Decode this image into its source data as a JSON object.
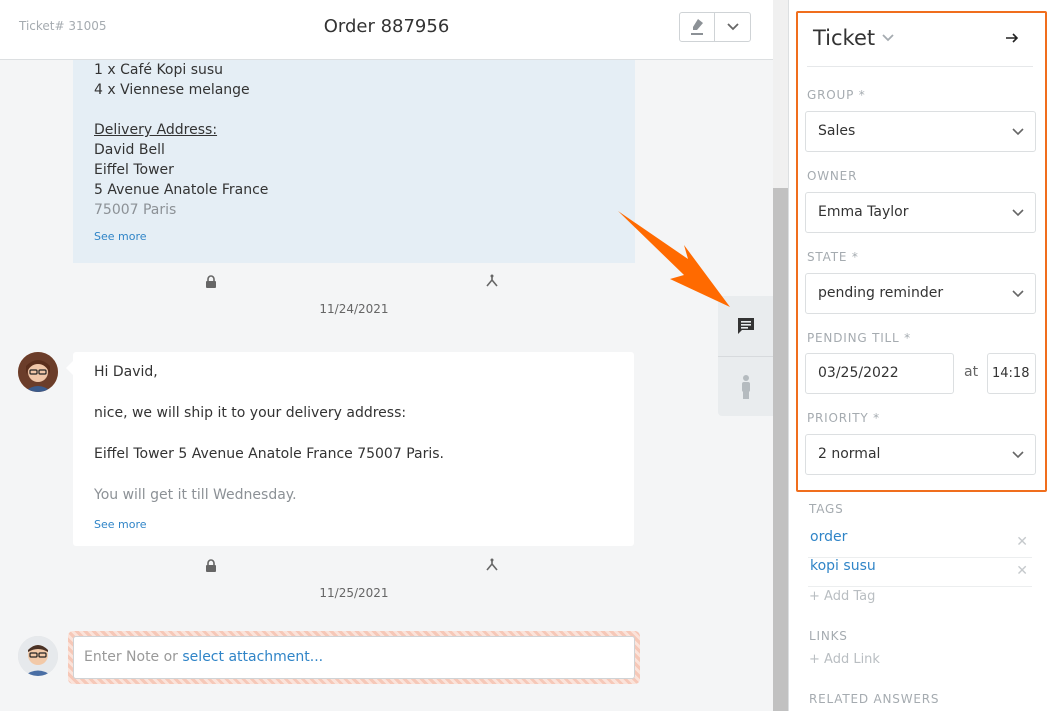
{
  "header": {
    "ticket_number": "Ticket# 31005",
    "title": "Order 887956"
  },
  "articles": [
    {
      "lines": [
        "1 x Café Kopi susu",
        "4 x Viennese melange",
        "",
        "Delivery Address:",
        "David Bell",
        "Eiffel Tower",
        "5 Avenue Anatole France",
        "75007 Paris"
      ],
      "see_more": "See more",
      "date": "11/24/2021"
    },
    {
      "paragraphs": [
        "Hi David,",
        "nice, we will ship it to your delivery address:",
        "Eiffel Tower 5 Avenue Anatole France 75007 Paris.",
        "You will get it till Wednesday."
      ],
      "see_more": "See more",
      "date": "11/25/2021"
    }
  ],
  "note": {
    "placeholder": "Enter Note or ",
    "attachment_link": "select attachment..."
  },
  "panel": {
    "title": "Ticket",
    "group_label": "GROUP *",
    "group_value": "Sales",
    "owner_label": "OWNER",
    "owner_value": "Emma Taylor",
    "state_label": "STATE *",
    "state_value": "pending reminder",
    "pending_label": "PENDING TILL *",
    "pending_date": "03/25/2022",
    "at_label": "at",
    "pending_time": "14:18",
    "priority_label": "PRIORITY *",
    "priority_value": "2 normal",
    "tags_label": "TAGS",
    "tags": [
      "order",
      "kopi susu"
    ],
    "add_tag": "+ Add Tag",
    "links_label": "LINKS",
    "add_link": "+ Add Link",
    "related_label": "RELATED ANSWERS"
  },
  "colors": {
    "accent": "#f06e1d",
    "link": "#2f84c7",
    "internal_article_bg": "#e5eef5"
  }
}
